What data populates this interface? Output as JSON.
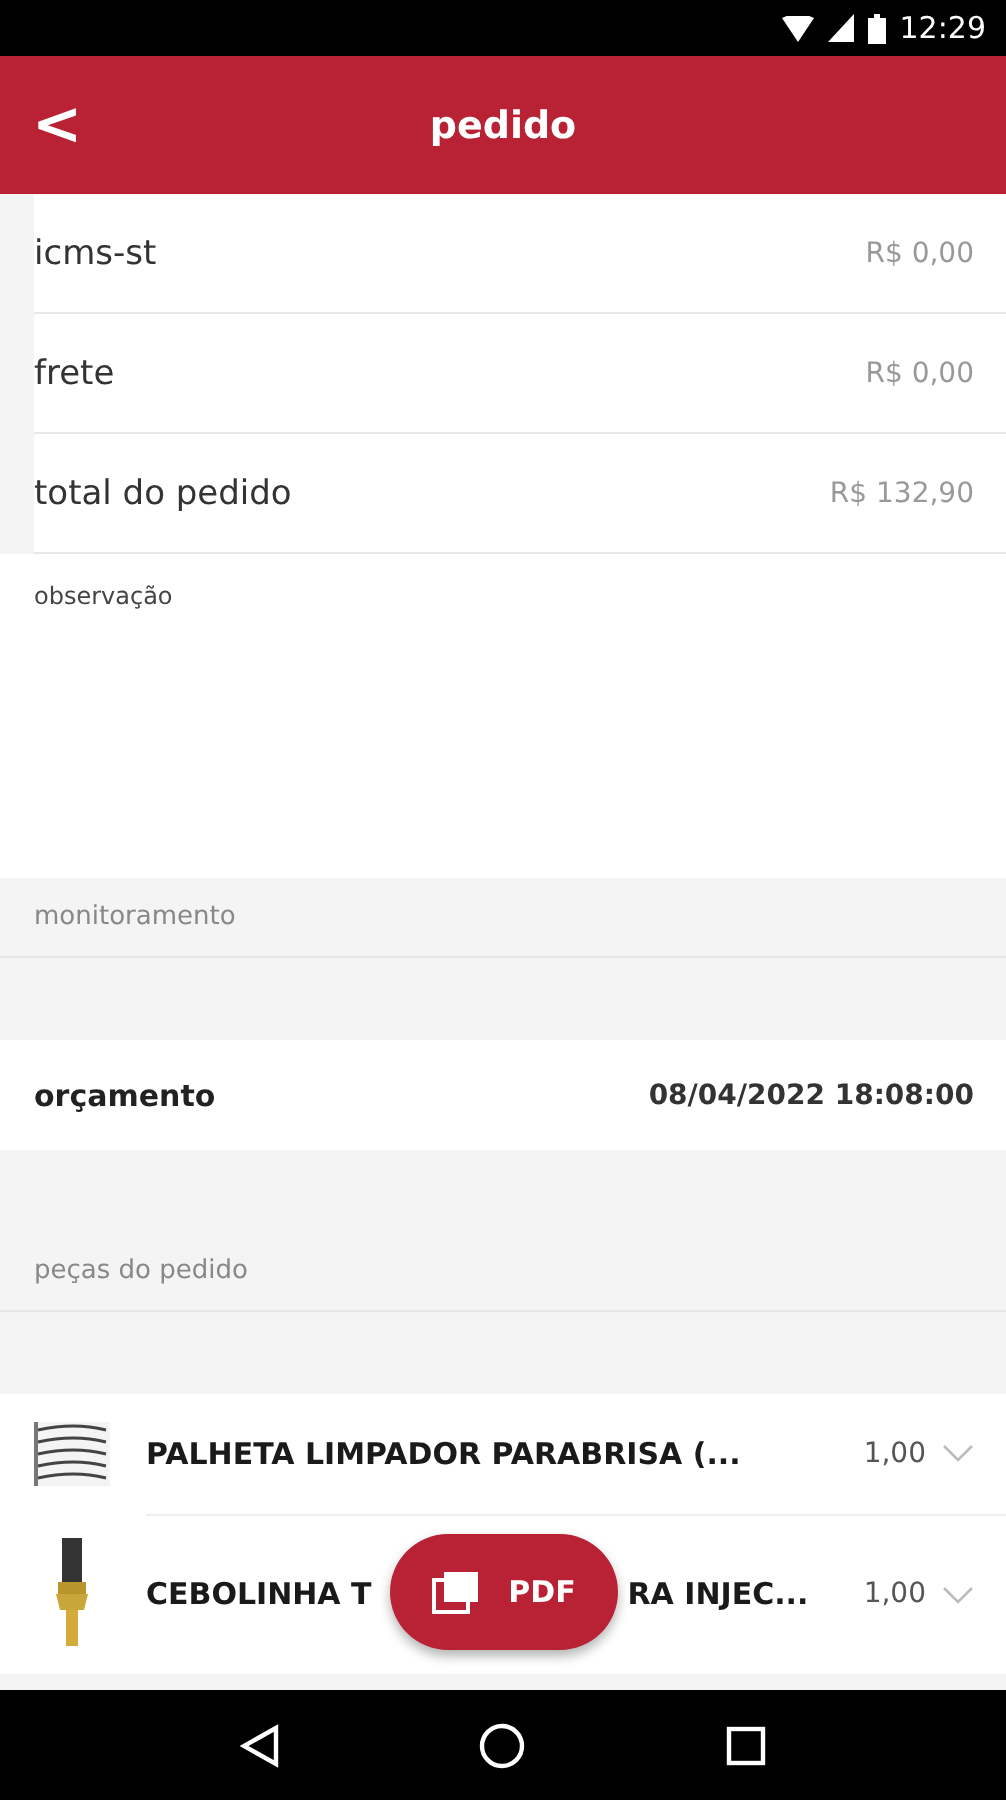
{
  "status_bar": {
    "time": "12:29"
  },
  "header": {
    "back": "<",
    "title": "pedido"
  },
  "summary": [
    {
      "label": "icms-st",
      "value": "R$ 0,00"
    },
    {
      "label": "frete",
      "value": "R$ 0,00"
    },
    {
      "label": "total do pedido",
      "value": "R$ 132,90"
    }
  ],
  "observation": {
    "label": "observação"
  },
  "monitoring": {
    "heading": "monitoramento",
    "status": "orçamento",
    "date": "08/04/2022 18:08:00"
  },
  "parts": {
    "heading": "peças do pedido",
    "items": [
      {
        "name_parts": [
          "PALHETA LIMPADOR PARABRISA (..."
        ],
        "quantity": "1,00",
        "kind": "picture"
      },
      {
        "name_parts": [
          "CEBOLINHA T",
          "RA INJEC..."
        ],
        "quantity": "1,00",
        "kind": "picture"
      }
    ]
  },
  "fab": {
    "label": "PDF"
  }
}
